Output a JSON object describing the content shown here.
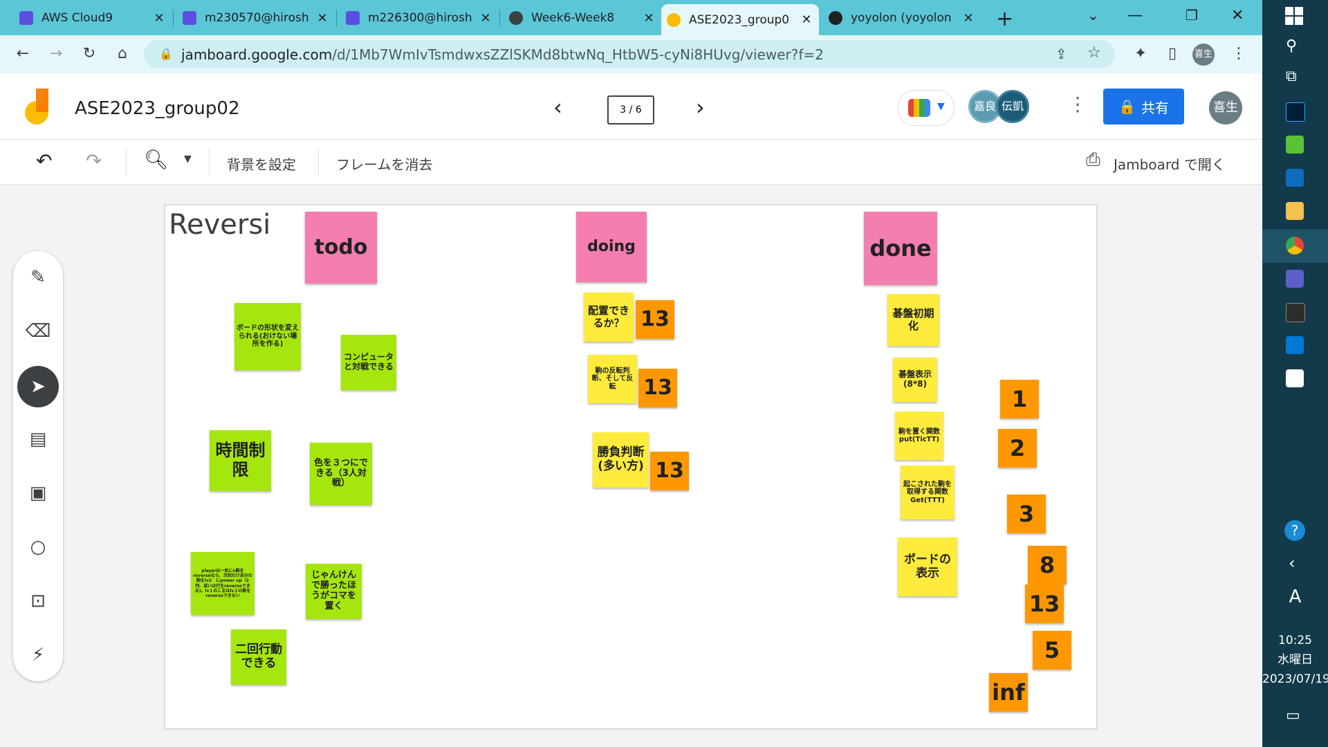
{
  "browser": {
    "tabs": [
      {
        "title": "AWS Cloud9",
        "color": "#5b4fe0"
      },
      {
        "title": "m230570@hirosh",
        "color": "#5b4fe0"
      },
      {
        "title": "m226300@hirosh",
        "color": "#5b4fe0"
      },
      {
        "title": "Week6-Week8",
        "color": "#3c4043"
      },
      {
        "title": "ASE2023_group0",
        "color": "#fbbc04"
      },
      {
        "title": "yoyolon (yoyolon",
        "color": "#202124"
      }
    ],
    "url_host": "jamboard.google.com",
    "url_path": "/d/1Mb7WmIvTsmdwxsZZlSKMd8btwNq_HtbW5-cyNi8HUvg/viewer?f=2",
    "profile_initial": "喜生"
  },
  "app": {
    "doc_title": "ASE2023_group02",
    "frame_counter": "3 / 6",
    "avatar1": "嘉良",
    "avatar2": "伝凱",
    "share_label": "共有",
    "account_avatar": "喜生"
  },
  "toolbar": {
    "set_background": "背景を設定",
    "clear_frame": "フレームを消去",
    "open_in_jamboard": "Jamboard で開く"
  },
  "board": {
    "title": "Reversi",
    "headers": {
      "todo": "todo",
      "doing": "doing",
      "done": "done"
    },
    "todo_notes": [
      "ボードの形状を変えられる(おけない場所を作る)",
      "コンピュータと対戦できる",
      "時間制限",
      "色を３つにできる（3人対戦）",
      "playerは一気にn駒をreverseなら、次回だけ自分の駒をlv2　にpower up（2列、或いは行をreverseできる)。lv１のこまはlv２の駒をreverseできない",
      "じゃんけんで勝ったほうがコマを置く",
      "二回行動できる"
    ],
    "doing_notes": [
      "配置できるか？",
      "駒の反転判断、そして反転",
      "勝負判断(多い方)"
    ],
    "doing_points": [
      "13",
      "13",
      "13"
    ],
    "done_notes": [
      "碁盤初期化",
      "碁盤表示(8*8)",
      "駒を置く関数put(TicTT)",
      "起こされた駒を取得する関数Get(TTT)",
      "ボードの表示"
    ],
    "points_cards": [
      "1",
      "2",
      "3",
      "8",
      "13",
      "5",
      "inf"
    ]
  },
  "taskbar": {
    "time": "10:25",
    "weekday": "水曜日",
    "date": "2023/07/19",
    "ime": "A"
  }
}
